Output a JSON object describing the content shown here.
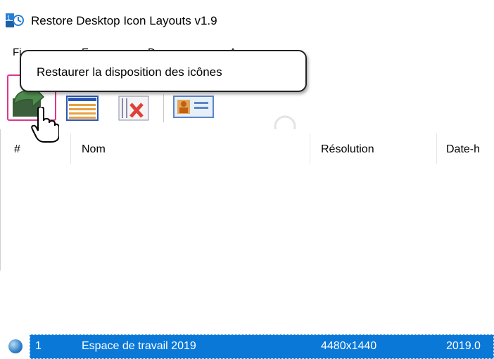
{
  "window": {
    "title": "Restore Desktop Icon Layouts v1.9"
  },
  "menu": {
    "items": [
      {
        "label": "Fi"
      },
      {
        "label": "E"
      },
      {
        "label": "D"
      },
      {
        "label": "A"
      }
    ]
  },
  "toolbar": {
    "tooltip": "Restaurer la disposition des icônes",
    "buttons": [
      "restore-layout",
      "save-layout",
      "delete-layout",
      "properties"
    ]
  },
  "table": {
    "columns": [
      "#",
      "Nom",
      "Résolution",
      "Date-h"
    ],
    "rows": [
      {
        "index": "1",
        "name": "Espace de travail 2019",
        "resolution": "4480x1440",
        "date": "2019.0"
      }
    ]
  },
  "colors": {
    "selection": "#0a78d7",
    "restore_border": "#e0348c"
  }
}
